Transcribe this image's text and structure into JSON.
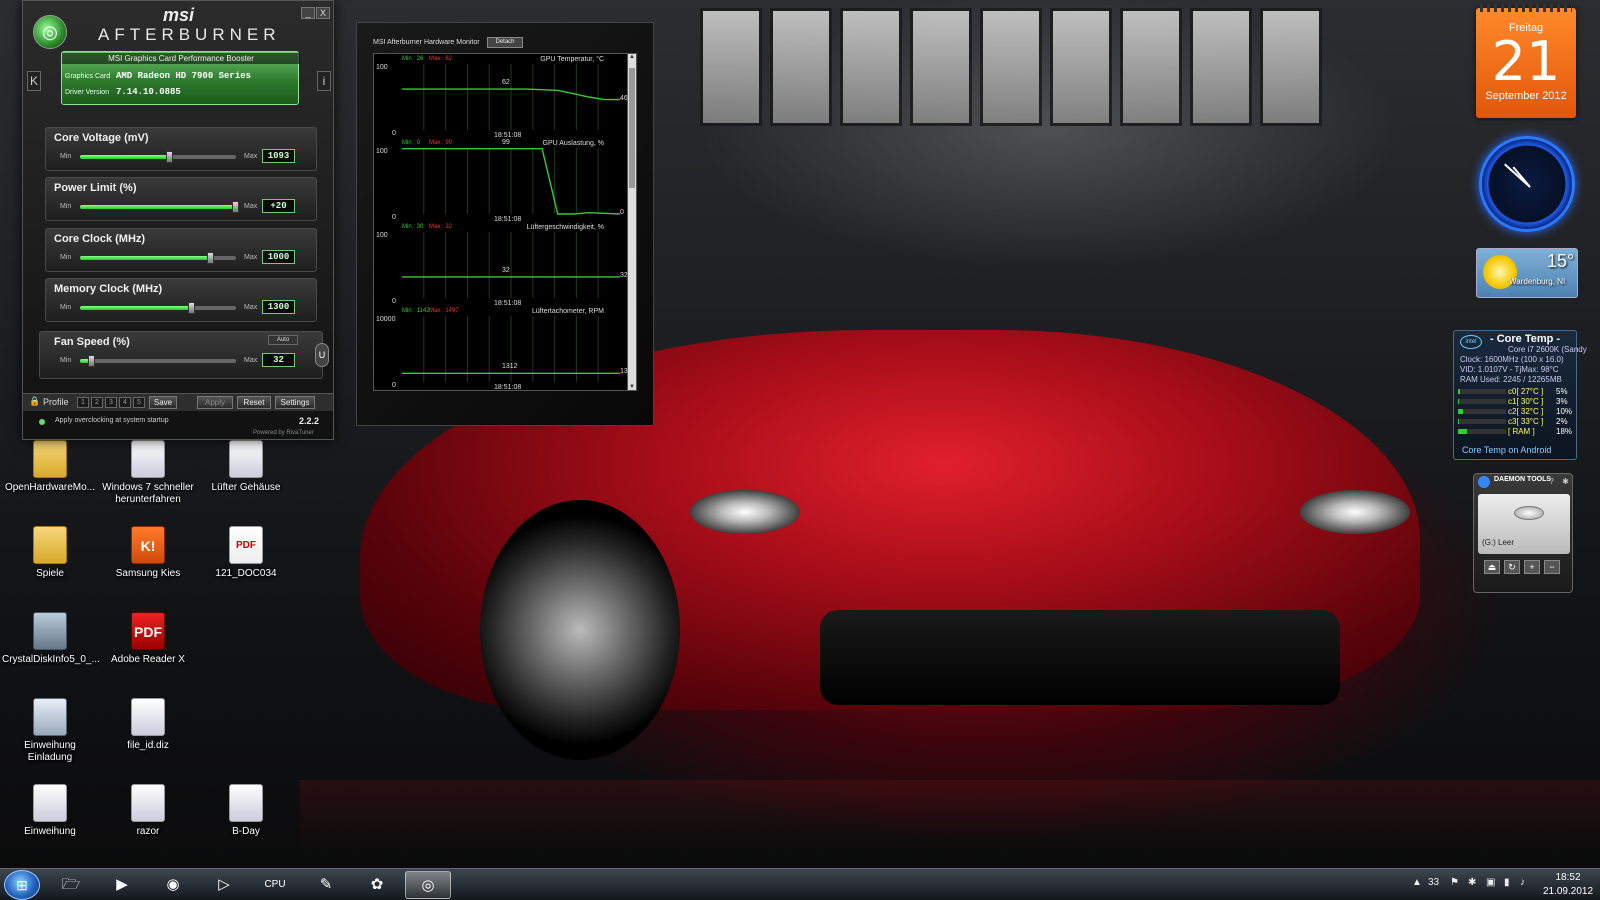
{
  "afterburner": {
    "brand": "msi",
    "title": "AFTERBURNER",
    "subtitle": "MSI Graphics Card Performance Booster",
    "graphics_card_label": "Graphics Card",
    "graphics_card": "AMD Radeon HD 7900 Series",
    "driver_label": "Driver Version",
    "driver_version": "7.14.10.0885",
    "left_btn": "K",
    "right_btn": "i",
    "minimize": "_",
    "close": "X",
    "min_label": "Min",
    "max_label": "Max",
    "sliders": [
      {
        "label": "Core Voltage (mV)",
        "value": "1093",
        "level": 0.58
      },
      {
        "label": "Power Limit (%)",
        "value": "+20",
        "level": 1.0
      },
      {
        "label": "Core Clock (MHz)",
        "value": "1000",
        "level": 0.84
      },
      {
        "label": "Memory Clock (MHz)",
        "value": "1300",
        "level": 0.72
      },
      {
        "label": "Fan Speed (%)",
        "value": "32",
        "level": 0.08
      }
    ],
    "fan_auto": "Auto",
    "user_define": "U",
    "profile_label": "Profile",
    "profile_slots": [
      "1",
      "2",
      "3",
      "4",
      "5"
    ],
    "save": "Save",
    "apply": "Apply",
    "reset": "Reset",
    "settings": "Settings",
    "startup_text": "Apply overclocking at system startup",
    "version": "2.2.2",
    "powered_by": "Powered by RivaTuner"
  },
  "hw_monitor": {
    "title": "MSI Afterburner Hardware Monitor",
    "detach": "Detach",
    "graphs": [
      {
        "name": "GPU Temperatur, °C",
        "min": "Min : 26",
        "max": "Max : 62",
        "ytop": "100",
        "ybot": "0",
        "time": "18:51:08",
        "label_a": "62",
        "label_b": "46",
        "points": [
          62,
          62,
          62,
          62,
          62,
          62,
          62,
          62,
          62,
          61,
          60,
          55,
          50,
          46,
          46
        ]
      },
      {
        "name": "GPU Auslastung, %",
        "min": "Min : 0",
        "max": "Max : 99",
        "ytop": "100",
        "ybot": "0",
        "time": "18:51:08",
        "label_a": "99",
        "label_b": "0",
        "points": [
          99,
          99,
          99,
          99,
          99,
          99,
          99,
          99,
          99,
          99,
          0,
          0,
          2,
          1,
          0
        ]
      },
      {
        "name": "Lüftergeschwindigkeit, %",
        "min": "Min : 30",
        "max": "Max : 32",
        "ytop": "100",
        "ybot": "0",
        "time": "18:51:08",
        "label_a": "32",
        "label_b": "32",
        "points": [
          32,
          32,
          32,
          32,
          32,
          32,
          32,
          32,
          32,
          32,
          32,
          32,
          32,
          32,
          32
        ]
      },
      {
        "name": "Lüftertachometer, RPM",
        "min": "Min : 1142",
        "max": "Max : 1497",
        "ytop": "10000",
        "ybot": "0",
        "time": "18:51:08",
        "label_a": "1312",
        "label_b": "1321",
        "points": [
          1312,
          1312,
          1312,
          1312,
          1312,
          1312,
          1312,
          1312,
          1312,
          1312,
          1315,
          1318,
          1320,
          1321,
          1321
        ]
      }
    ]
  },
  "desktop_icons": [
    {
      "label": "OpenHardwareMo...",
      "icon": "folder-icon"
    },
    {
      "label": "Windows 7 schneller herunterfahren",
      "icon": "document-icon"
    },
    {
      "label": "Lüfter Gehäuse",
      "icon": "document-icon"
    },
    {
      "label": "Spiele",
      "icon": "folder-icon"
    },
    {
      "label": "Samsung Kies",
      "icon": "kies-icon"
    },
    {
      "label": "121_DOC034",
      "icon": "pdf-icon"
    },
    {
      "label": "CrystalDiskInfo5_0_...",
      "icon": "crystaldisk-icon"
    },
    {
      "label": "Adobe Reader X",
      "icon": "adobe-reader-icon"
    },
    {
      "label": "Einweihung Einladung",
      "icon": "setup-icon"
    },
    {
      "label": "file_id.diz",
      "icon": "document-icon"
    },
    {
      "label": "Einweihung",
      "icon": "document-icon"
    },
    {
      "label": "razor",
      "icon": "document-icon"
    },
    {
      "label": "B-Day",
      "icon": "document-icon"
    }
  ],
  "icon_glyphs": {
    "kies": "K!",
    "pdf": "PDF"
  },
  "calendar": {
    "weekday": "Freitag",
    "day": "21",
    "month_year": "September 2012"
  },
  "weather": {
    "temp": "15°",
    "location": "Wardenburg, NI"
  },
  "coretemp": {
    "title": "- Core Temp -",
    "intel": "intel",
    "cpu": "Core i7 2600K (Sandy",
    "clock": "Clock: 1600MHz (100 x 16.0)",
    "vid": "VID: 1.0107V - TjMax: 98°C",
    "ram": "RAM Used: 2245 / 12265MB",
    "cores": [
      {
        "label": "c0[ 27°C ]",
        "pct": "5%",
        "level": 0.05
      },
      {
        "label": "c1[ 30°C ]",
        "pct": "3%",
        "level": 0.03
      },
      {
        "label": "c2[ 32°C ]",
        "pct": "10%",
        "level": 0.1
      },
      {
        "label": "c3[ 33°C ]",
        "pct": "2%",
        "level": 0.02
      },
      {
        "label": "[ RAM ]",
        "pct": "18%",
        "level": 0.18
      }
    ],
    "android": "Core Temp on Android"
  },
  "daemon": {
    "title": "DAEMON TOOLS",
    "help": "?",
    "drive": "(G:) Leer"
  },
  "taskbar": {
    "start": "⊞",
    "apps": [
      {
        "icon": "explorer-icon",
        "glyph": "🗁"
      },
      {
        "icon": "media-player-icon",
        "glyph": "▶"
      },
      {
        "icon": "firefox-icon",
        "glyph": "◉"
      },
      {
        "icon": "media-center-icon",
        "glyph": "▷"
      },
      {
        "icon": "cpuz-icon",
        "glyph": "CPU"
      },
      {
        "icon": "tools-icon",
        "glyph": "✎"
      },
      {
        "icon": "icq-icon",
        "glyph": "✿"
      },
      {
        "icon": "afterburner-icon",
        "glyph": "◎"
      }
    ],
    "tray_count": "33",
    "time": "18:52",
    "date": "21.09.2012"
  }
}
